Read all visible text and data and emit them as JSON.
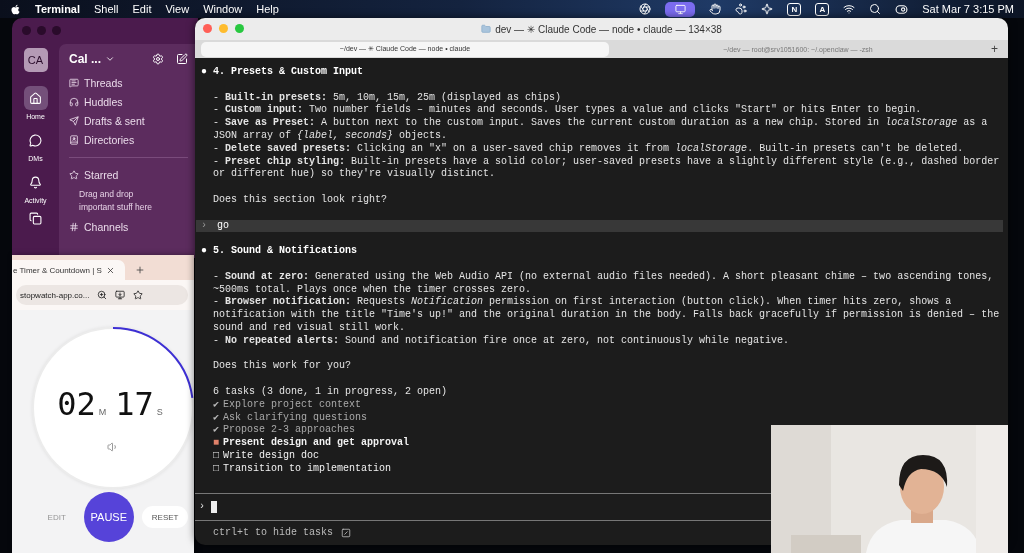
{
  "menu_bar": {
    "app": "Terminal",
    "menus": [
      "Shell",
      "Edit",
      "View",
      "Window",
      "Help"
    ],
    "extras": [
      "N",
      "A"
    ],
    "clock": "Sat Mar 7  3:15 PM"
  },
  "slack": {
    "avatar": "CA",
    "rail": [
      {
        "label": "Home",
        "selected": true
      },
      {
        "label": "DMs",
        "selected": false
      },
      {
        "label": "Activity",
        "selected": false
      }
    ],
    "workspace": "Cal ...",
    "nav": [
      "Threads",
      "Huddles",
      "Drafts & sent",
      "Directories"
    ],
    "starred": {
      "title": "Starred",
      "hint": "Drag and drop important stuff here"
    },
    "channels": "Channels"
  },
  "browser": {
    "tab": "e Timer & Countdown | S",
    "url": "stopwatch-app.co...",
    "timer": {
      "minutes": "02",
      "minutes_unit": "M",
      "seconds": "17",
      "seconds_unit": "S"
    },
    "buttons": [
      {
        "label": "EDIT",
        "kind": "ghost",
        "disabled": true
      },
      {
        "label": "PAUSE",
        "kind": "primary",
        "disabled": false
      },
      {
        "label": "RESET",
        "kind": "secondary",
        "disabled": false
      }
    ]
  },
  "terminal": {
    "title": "dev — ✳ Claude Code — node • claude — 134×38",
    "tabs": [
      {
        "label": "~/dev — ✳ Claude Code — node • claude",
        "selected": true
      },
      {
        "label": "~/dev — root@srv1051600: ~/.openclaw — -zsh",
        "selected": false
      }
    ],
    "new_tab": "+",
    "blocks": [
      {
        "kind": "heading",
        "bullet": "●",
        "text": "4. Presets & Custom Input"
      },
      {
        "kind": "list",
        "items": [
          "- **Built-in presets:** 5m, 10m, 15m, 25m (displayed as chips)",
          "- **Custom input:** Two number fields – minutes and seconds. User types a value and clicks \"Start\" or hits Enter to begin.",
          "- **Save as Preset:** A button next to the custom input. Saves the current custom duration as a new chip. Stored in *localStorage* as a JSON array of *{label, seconds}* objects.",
          "- **Delete saved presets:** Clicking an \"x\" on a user-saved chip removes it from *localStorage*. Built-in presets can't be deleted.",
          "- **Preset chip styling:** Built-in presets have a solid color; user-saved presets have a slightly different style (e.g., dashed border or different hue) so they're visually distinct."
        ]
      },
      {
        "kind": "text",
        "text": "Does this section look right?"
      },
      {
        "kind": "prompt",
        "prompt": "›",
        "text": "go"
      },
      {
        "kind": "heading",
        "bullet": "●",
        "text": "5. Sound & Notifications"
      },
      {
        "kind": "list",
        "items": [
          "- **Sound at zero:** Generated using the Web Audio API (no external audio files needed). A short pleasant chime – two ascending tones, ~500ms total. Plays once when the timer crosses zero.",
          "- **Browser notification:** Requests *Notification* permission on first interaction (button click). When timer hits zero, shows a notification with the title \"Time's up!\" and the original duration in the body. Falls back gracefully if permission is denied – the sound and red visual still work.",
          "- **No repeated alerts:** Sound and notification fire once at zero, not continuously while negative."
        ]
      },
      {
        "kind": "text",
        "text": "Does this work for you?"
      },
      {
        "kind": "tasks",
        "summary": "6 tasks (3 done, 1 in progress, 2 open)",
        "items": [
          {
            "mark": "✔",
            "label": "Explore project context",
            "kind": "done"
          },
          {
            "mark": "✔",
            "label": "Ask clarifying questions",
            "kind": "done"
          },
          {
            "mark": "✔",
            "label": "Propose 2-3 approaches",
            "kind": "done"
          },
          {
            "mark": "■",
            "label": "Present design and get approval",
            "kind": "in_progress"
          },
          {
            "mark": "□",
            "label": "Write design doc",
            "kind": "open"
          },
          {
            "mark": "□",
            "label": "Transition to implementation",
            "kind": "open"
          }
        ]
      }
    ],
    "input": {
      "prompt": "›"
    },
    "footer": "ctrl+t to hide tasks"
  }
}
